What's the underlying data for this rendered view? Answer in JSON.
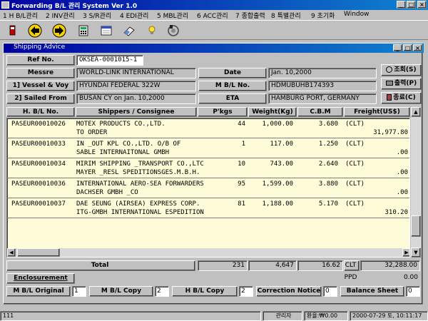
{
  "app": {
    "title": "Forwarding B/L 관리 System Ver 1.0",
    "controls": {
      "minimize": "_",
      "maximize": "□",
      "close": "×"
    }
  },
  "menu": [
    "1 H B/L관리",
    "2 INV관리",
    "3 S/R관리",
    "4 EDI관리",
    "5 MBL관리",
    "6 ACC관리",
    "7 종합출력",
    "8 특별관리",
    "9 초기화",
    "Window"
  ],
  "toolbar_icons": [
    "exit-icon",
    "prev-arrow-icon",
    "next-arrow-icon",
    "calculator-icon",
    "calendar-icon",
    "eraser-icon",
    "help-bulb-icon",
    "phone-icon"
  ],
  "window": {
    "title": "Shipping Advice",
    "controls": {
      "minimize": "_",
      "maximize": "□",
      "close": "×"
    }
  },
  "form": {
    "ref_no": {
      "label": "Ref No.",
      "value": "OKSEA-0001015-1"
    },
    "messre": {
      "label": "Messre",
      "value": "WORLD-LINK INTERNATIONAL"
    },
    "vessel": {
      "label": "1] Vessel & Voy",
      "value": "HYUNDAI FEDERAL 322W"
    },
    "sailed": {
      "label": "2] Sailed From",
      "value": "BUSAN CY on Jan. 10,2000"
    },
    "date": {
      "label": "Date",
      "value": "Jan. 10,2000"
    },
    "mbl": {
      "label": "M B/L No.",
      "value": "HDMUBUHB174393"
    },
    "eta": {
      "label": "ETA",
      "value": "HAMBURG PORT, GERMANY"
    }
  },
  "buttons": {
    "lookup": "조회(S)",
    "print": "출력(P)",
    "exit": "종료(C)"
  },
  "table": {
    "headers": [
      "H. B/L No.",
      "Shippers / Consignee",
      "P'kgs",
      "Weight(Kg)",
      "C.B.M",
      "Freight(US$)"
    ],
    "rows": [
      {
        "hbl": "PASEUR00010026",
        "shipper": "MOTEX PRODUCTS CO.,LTD.",
        "consignee": "TO ORDER",
        "pkgs": "44",
        "weight": "1,000.00",
        "cbm": "3.680",
        "term": "(CLT)",
        "freight": "31,977.80"
      },
      {
        "hbl": "PASEUR00010033",
        "shipper": "IN _OUT KPL CO.,LTD. O/B OF",
        "consignee": "SABLE INTERNAITONAL GMBH",
        "pkgs": "1",
        "weight": "117.00",
        "cbm": "1.250",
        "term": "(CLT)",
        "freight": ".00"
      },
      {
        "hbl": "PASEUR00010034",
        "shipper": "MIRIM SHIPPING _TRANSPORT CO.,LTC",
        "consignee": "MAYER _RESL SPEDITIONSGES.M.B.H.",
        "pkgs": "10",
        "weight": "743.00",
        "cbm": "2.640",
        "term": "(CLT)",
        "freight": ".00"
      },
      {
        "hbl": "PASEUR00010036",
        "shipper": "INTERNATIONAL AERO-SEA FORWARDERS",
        "consignee": "DACHSER GMBH _CO",
        "pkgs": "95",
        "weight": "1,599.00",
        "cbm": "3.880",
        "term": "(CLT)",
        "freight": ".00"
      },
      {
        "hbl": "PASEUR00010037",
        "shipper": "DAE SEUNG (AIRSEA) EXPRESS CORP.",
        "consignee": "ITG-GMBH INTERNATIONAL ESPEDITION",
        "pkgs": "81",
        "weight": "1,188.00",
        "cbm": "5.170",
        "term": "(CLT)",
        "freight": "310.20"
      }
    ]
  },
  "totals": {
    "label": "Total",
    "pkgs": "231",
    "weight": "4,647",
    "cbm": "16.62",
    "clt_label": "CLT",
    "clt_value": "32,288.00",
    "ppd_label": "PPD",
    "ppd_value": "0.00"
  },
  "bottom": {
    "enclosure": "Enclosurement",
    "mbl_original": {
      "label": "M B/L Original",
      "value": "1"
    },
    "mbl_copy": {
      "label": "M B/L Copy",
      "value": "2"
    },
    "hbl_copy": {
      "label": "H B/L Copy",
      "value": "2"
    },
    "correction": {
      "label": "Correction Notice",
      "value": "0"
    },
    "balance": {
      "label": "Balance Sheet",
      "value": "0"
    }
  },
  "status": {
    "left": "111",
    "user": "관리자",
    "rate": "환율:₩0.00",
    "datetime": "2000-07-29 토, 10:11:17"
  },
  "colors": {
    "grid_bg": "#fdfbd8",
    "titlebar": "#0000a0",
    "face": "#c0c0c0"
  }
}
